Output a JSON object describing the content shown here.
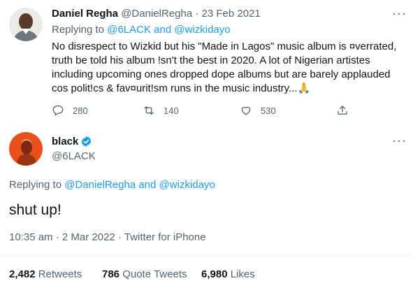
{
  "original_tweet": {
    "author_name": "Daniel Regha",
    "author_handle": "@DanielRegha",
    "separator": "·",
    "date": "23 Feb 2021",
    "replying_to_label": "Replying to",
    "replying_to_1": "@6LACK",
    "replying_and": "and",
    "replying_to_2": "@wizkidayo",
    "text": "No disrespect to Wizkid but his \"Made in Lagos\" music album is ¤verrated, truth be told his album !sn't the best in 2020. A lot of Nigerian artistes including upcoming ones dropped dope albums but are barely applauded cos polit!cs & fav¤urit!sm runs in the music industry...🙏",
    "replies": "280",
    "retweets": "140",
    "likes": "530"
  },
  "reply_tweet": {
    "author_name": "black",
    "author_handle": "@6LACK",
    "verified": true,
    "replying_to_label": "Replying to",
    "replying_to_1": "@DanielRegha",
    "replying_and": "and",
    "replying_to_2": "@wizkidayo",
    "text": "shut up!",
    "time": "10:35 am",
    "separator": "·",
    "date": "2 Mar 2022",
    "separator2": "·",
    "source": "Twitter for iPhone"
  },
  "stats": {
    "retweets_count": "2,482",
    "retweets_label": "Retweets",
    "quote_count": "786",
    "quote_label": "Quote Tweets",
    "likes_count": "6,980",
    "likes_label": "Likes"
  },
  "colors": {
    "accent": "#1d9bf0",
    "muted": "#536471",
    "text": "#0f1419"
  },
  "icons": {
    "reply": "speech-bubble-icon",
    "retweet": "retweet-icon",
    "like": "heart-icon",
    "share": "share-icon",
    "more": "more-dots-icon",
    "verified": "verified-badge-icon"
  }
}
